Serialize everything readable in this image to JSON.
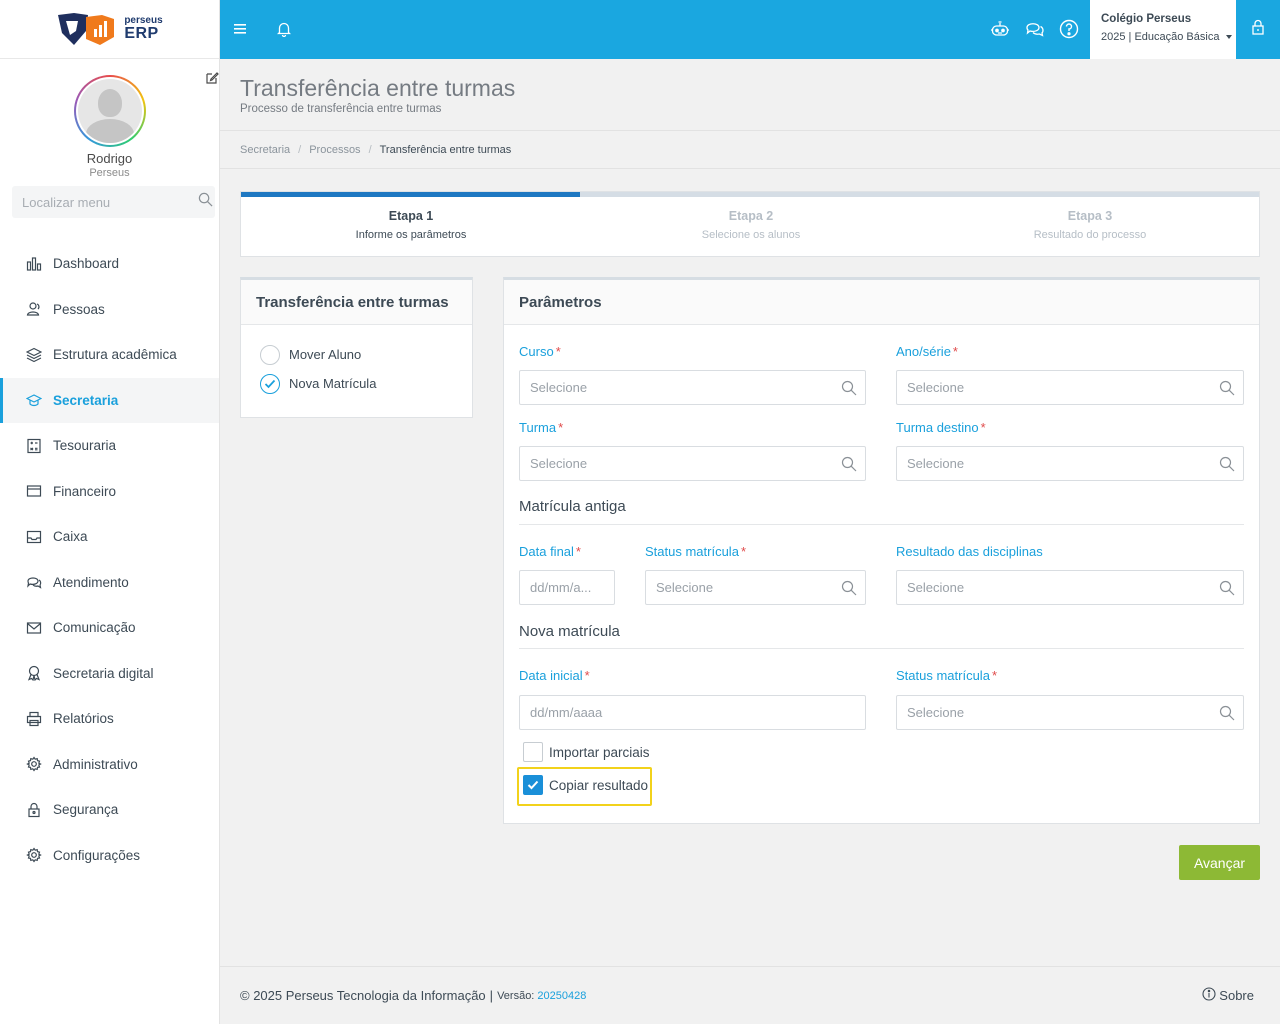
{
  "brand": {
    "logo_top": "perseus",
    "logo_bottom": "ERP"
  },
  "profile": {
    "name": "Rodrigo",
    "org": "Perseus"
  },
  "sidebar": {
    "search_placeholder": "Localizar menu",
    "items": [
      {
        "label": "Dashboard",
        "icon": "chart-bar-icon"
      },
      {
        "label": "Pessoas",
        "icon": "users-icon"
      },
      {
        "label": "Estrutura acadêmica",
        "icon": "layers-icon"
      },
      {
        "label": "Secretaria",
        "icon": "graduation-cap-icon",
        "active": true
      },
      {
        "label": "Tesouraria",
        "icon": "calculator-icon"
      },
      {
        "label": "Financeiro",
        "icon": "credit-card-icon"
      },
      {
        "label": "Caixa",
        "icon": "inbox-icon"
      },
      {
        "label": "Atendimento",
        "icon": "chat-icon"
      },
      {
        "label": "Comunicação",
        "icon": "mail-icon"
      },
      {
        "label": "Secretaria digital",
        "icon": "award-icon"
      },
      {
        "label": "Relatórios",
        "icon": "printer-icon"
      },
      {
        "label": "Administrativo",
        "icon": "gear-icon"
      },
      {
        "label": "Segurança",
        "icon": "lock-icon"
      },
      {
        "label": "Configurações",
        "icon": "gear-icon"
      }
    ]
  },
  "topbar": {
    "school_name": "Colégio Perseus",
    "school_period": "2025 | Educação Básica"
  },
  "header": {
    "title": "Transferência entre turmas",
    "subtitle": "Processo de transferência entre turmas"
  },
  "breadcrumb": [
    "Secretaria",
    "Processos",
    "Transferência entre turmas"
  ],
  "steps": [
    {
      "title": "Etapa 1",
      "subtitle": "Informe os parâmetros"
    },
    {
      "title": "Etapa 2",
      "subtitle": "Selecione os alunos"
    },
    {
      "title": "Etapa 3",
      "subtitle": "Resultado do processo"
    }
  ],
  "steps_progress": 0.333,
  "left_card": {
    "title": "Transferência entre turmas",
    "options": [
      {
        "label": "Mover Aluno",
        "checked": false
      },
      {
        "label": "Nova Matrícula",
        "checked": true
      }
    ]
  },
  "params": {
    "title": "Parâmetros",
    "curso": {
      "label": "Curso",
      "placeholder": "Selecione"
    },
    "ano_serie": {
      "label": "Ano/série",
      "placeholder": "Selecione"
    },
    "turma": {
      "label": "Turma",
      "placeholder": "Selecione"
    },
    "turma_destino": {
      "label": "Turma destino",
      "placeholder": "Selecione"
    },
    "old_section": "Matrícula antiga",
    "data_final": {
      "label": "Data final",
      "placeholder": "dd/mm/a..."
    },
    "status_old": {
      "label": "Status matrícula",
      "placeholder": "Selecione"
    },
    "resultado": {
      "label": "Resultado das disciplinas",
      "placeholder": "Selecione"
    },
    "new_section": "Nova matrícula",
    "data_inicial": {
      "label": "Data inicial",
      "placeholder": "dd/mm/aaaa"
    },
    "status_new": {
      "label": "Status matrícula",
      "placeholder": "Selecione"
    },
    "importar_parciais": {
      "label": "Importar parciais",
      "checked": false
    },
    "copiar_resultado": {
      "label": "Copiar resultado",
      "checked": true
    },
    "required_mark": "*"
  },
  "actions": {
    "next": "Avançar"
  },
  "footer": {
    "copyright": "© 2025 Perseus Tecnologia da Informação",
    "separator": "|",
    "version_label": "Versão:",
    "version": "20250428",
    "about": "Sobre"
  },
  "colors": {
    "accent": "#1aa7e0",
    "success": "#8db935",
    "highlight": "#f2d21b"
  }
}
